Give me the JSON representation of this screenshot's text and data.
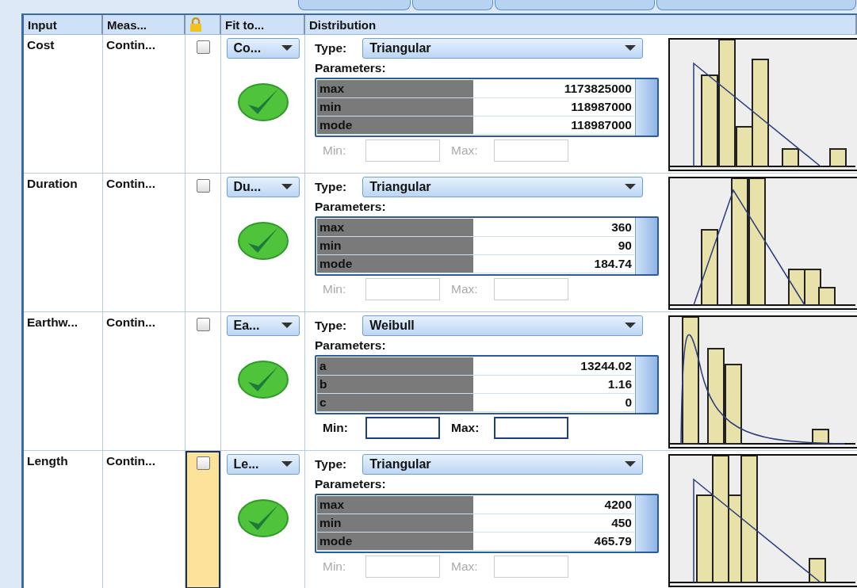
{
  "columns": [
    {
      "label": "Input",
      "kind": "text"
    },
    {
      "label": "Meas...",
      "kind": "text"
    },
    {
      "kind": "lock"
    },
    {
      "label": "Fit to...",
      "kind": "text"
    },
    {
      "label": "Distribution",
      "kind": "text"
    }
  ],
  "rows": [
    {
      "input": "Cost",
      "measure": "Contin...",
      "locked": false,
      "selected": false,
      "fit": "Co...",
      "fitted": true,
      "type_label": "Type:",
      "type": "Triangular",
      "params_label": "Parameters:",
      "params": [
        {
          "name": "max",
          "value": "1173825000"
        },
        {
          "name": "min",
          "value": "118987000"
        },
        {
          "name": "mode",
          "value": "118987000"
        }
      ],
      "min_label": "Min:",
      "max_label": "Max:",
      "range_enabled": false
    },
    {
      "input": "Duration",
      "measure": "Contin...",
      "locked": false,
      "selected": false,
      "fit": "Du...",
      "fitted": true,
      "type_label": "Type:",
      "type": "Triangular",
      "params_label": "Parameters:",
      "params": [
        {
          "name": "max",
          "value": "360"
        },
        {
          "name": "min",
          "value": "90"
        },
        {
          "name": "mode",
          "value": "184.74"
        }
      ],
      "min_label": "Min:",
      "max_label": "Max:",
      "range_enabled": false
    },
    {
      "input": "Earthw...",
      "measure": "Contin...",
      "locked": false,
      "selected": false,
      "fit": "Ea...",
      "fitted": true,
      "type_label": "Type:",
      "type": "Weibull",
      "params_label": "Parameters:",
      "params": [
        {
          "name": "a",
          "value": "13244.02"
        },
        {
          "name": "b",
          "value": "1.16"
        },
        {
          "name": "c",
          "value": "0"
        }
      ],
      "min_label": "Min:",
      "max_label": "Max:",
      "range_enabled": true
    },
    {
      "input": "Length",
      "measure": "Contin...",
      "locked": false,
      "selected": true,
      "fit": "Le...",
      "fitted": true,
      "type_label": "Type:",
      "type": "Triangular",
      "params_label": "Parameters:",
      "params": [
        {
          "name": "max",
          "value": "4200"
        },
        {
          "name": "min",
          "value": "450"
        },
        {
          "name": "mode",
          "value": "465.79"
        }
      ],
      "min_label": "Min:",
      "max_label": "Max:",
      "range_enabled": false
    }
  ]
}
